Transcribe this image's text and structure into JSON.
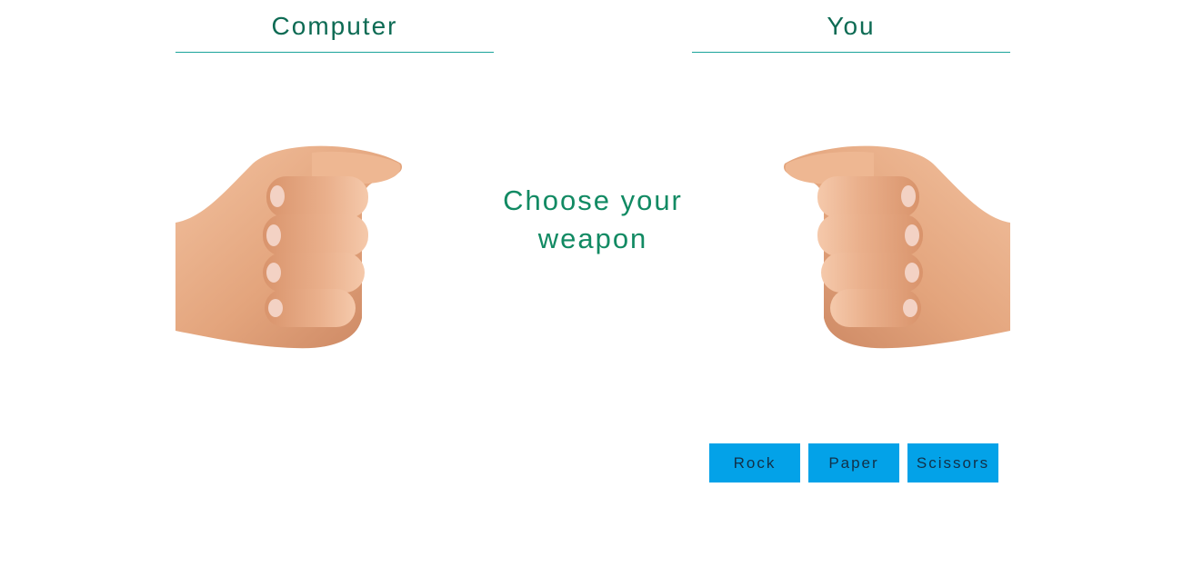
{
  "players": {
    "computer_label": "Computer",
    "you_label": "You"
  },
  "prompt": {
    "line1": "Choose your",
    "line2": "weapon"
  },
  "hands": {
    "computer_icon": "rock-fist-icon",
    "you_icon": "rock-fist-icon",
    "skin_color": "#e3a47c"
  },
  "weapons": {
    "rock_label": "Rock",
    "paper_label": "Paper",
    "scissors_label": "Scissors"
  },
  "colors": {
    "heading_text": "#0e6b54",
    "divider": "#1aa39a",
    "prompt_text": "#128a63",
    "button_bg": "#03a2e8"
  }
}
